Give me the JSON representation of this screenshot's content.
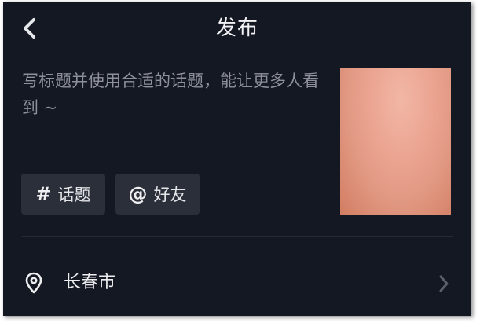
{
  "header": {
    "title": "发布",
    "back_icon": "chevron-left-icon"
  },
  "caption": {
    "placeholder": "写标题并使用合适的话题，能让更多人看到 ~"
  },
  "thumbnail": {
    "colors": [
      "#f2b7a5",
      "#eba592",
      "#d27d62"
    ]
  },
  "chips": {
    "topic": {
      "glyph": "#",
      "label": "话题"
    },
    "friend": {
      "glyph": "@",
      "label": "好友"
    }
  },
  "location": {
    "icon": "location-pin-icon",
    "label": "长春市",
    "chevron_icon": "chevron-right-icon"
  },
  "colors": {
    "background": "#141823",
    "chip_background": "#2b2f39",
    "placeholder_text": "#8e919b",
    "primary_text": "#f2f2f4"
  }
}
